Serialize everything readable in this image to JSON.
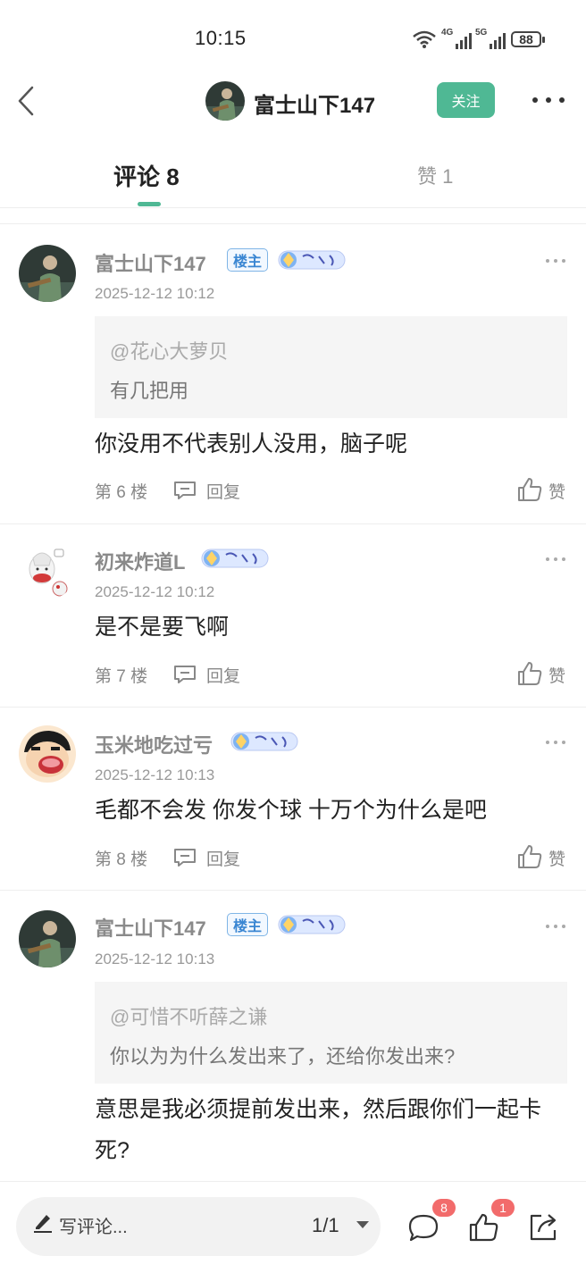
{
  "status_bar": {
    "time": "10:15",
    "network_1": "4G",
    "network_2": "5G",
    "battery": "88"
  },
  "header": {
    "title": "富士山下147",
    "follow_label": "关注"
  },
  "tabs": {
    "comments": "评论 8",
    "likes": "赞 1"
  },
  "comments": [
    {
      "user": "富士山下147",
      "owner_badge": "楼主",
      "date": "2025-12-12 10:12",
      "quote_user": "@花心大萝贝",
      "quote_text": "有几把用",
      "text": "你没用不代表别人没用，脑子呢",
      "floor": "第 6 楼",
      "reply": "回复",
      "like": "赞"
    },
    {
      "user": "初来炸道L",
      "date": "2025-12-12 10:12",
      "text": "是不是要飞啊",
      "floor": "第 7 楼",
      "reply": "回复",
      "like": "赞"
    },
    {
      "user": "玉米地吃过亏",
      "date": "2025-12-12 10:13",
      "text": "毛都不会发 你发个球 十万个为什么是吧",
      "floor": "第 8 楼",
      "reply": "回复",
      "like": "赞"
    },
    {
      "user": "富士山下147",
      "owner_badge": "楼主",
      "date": "2025-12-12 10:13",
      "quote_user": "@可惜不听薛之谦",
      "quote_text": "你以为为什么发出来了，还给你发出来?",
      "text": "意思是我必须提前发出来，然后跟你们一起卡死?"
    }
  ],
  "bottom_bar": {
    "write_placeholder": "写评论...",
    "page": "1/1",
    "comment_count": "8",
    "like_count": "1"
  },
  "colors": {
    "accent": "#4fb894",
    "badge_red": "#f26b6b",
    "owner_blue": "#3a86d2"
  }
}
